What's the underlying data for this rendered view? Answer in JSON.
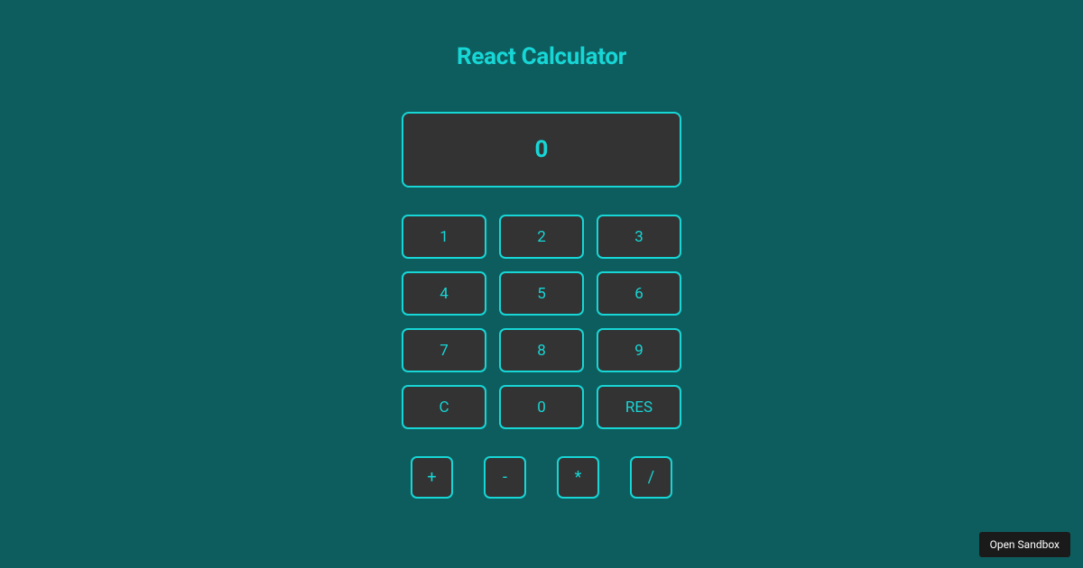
{
  "title": "React Calculator",
  "display_value": "0",
  "keypad": {
    "rows": [
      [
        "1",
        "2",
        "3"
      ],
      [
        "4",
        "5",
        "6"
      ],
      [
        "7",
        "8",
        "9"
      ],
      [
        "C",
        "0",
        "RES"
      ]
    ]
  },
  "operators": [
    "+",
    "-",
    "*",
    "/"
  ],
  "sandbox_button": "Open Sandbox",
  "colors": {
    "background": "#0e5d5e",
    "accent": "#17d6d6",
    "button_bg": "#333333"
  }
}
